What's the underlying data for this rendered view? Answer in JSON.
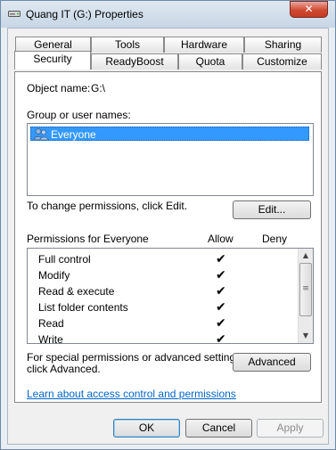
{
  "window": {
    "title": "Quang IT (G:) Properties",
    "close_glyph": "✕",
    "icon": "drive-icon"
  },
  "tabs_row1": [
    "General",
    "Tools",
    "Hardware",
    "Sharing"
  ],
  "tabs_row2": [
    "Security",
    "ReadyBoost",
    "Quota",
    "Customize"
  ],
  "active_tab": "Security",
  "security": {
    "object_name_label": "Object name:",
    "object_name_value": "G:\\",
    "group_label": "Group or user names:",
    "groups": [
      {
        "name": "Everyone",
        "icon": "users-icon",
        "selected": true
      }
    ],
    "change_hint": "To change permissions, click Edit.",
    "edit_button": "Edit...",
    "permissions_label": "Permissions for Everyone",
    "allow_header": "Allow",
    "deny_header": "Deny",
    "permissions": [
      {
        "name": "Full control",
        "allow": true,
        "deny": false
      },
      {
        "name": "Modify",
        "allow": true,
        "deny": false
      },
      {
        "name": "Read & execute",
        "allow": true,
        "deny": false
      },
      {
        "name": "List folder contents",
        "allow": true,
        "deny": false
      },
      {
        "name": "Read",
        "allow": true,
        "deny": false
      },
      {
        "name": "Write",
        "allow": true,
        "deny": false
      }
    ],
    "check_glyph": "✔",
    "special_hint_line1": "For special permissions or advanced settings,",
    "special_hint_line2": "click Advanced.",
    "advanced_button": "Advanced",
    "learn_link": "Learn about access control and permissions"
  },
  "footer": {
    "ok": "OK",
    "cancel": "Cancel",
    "apply": "Apply"
  }
}
